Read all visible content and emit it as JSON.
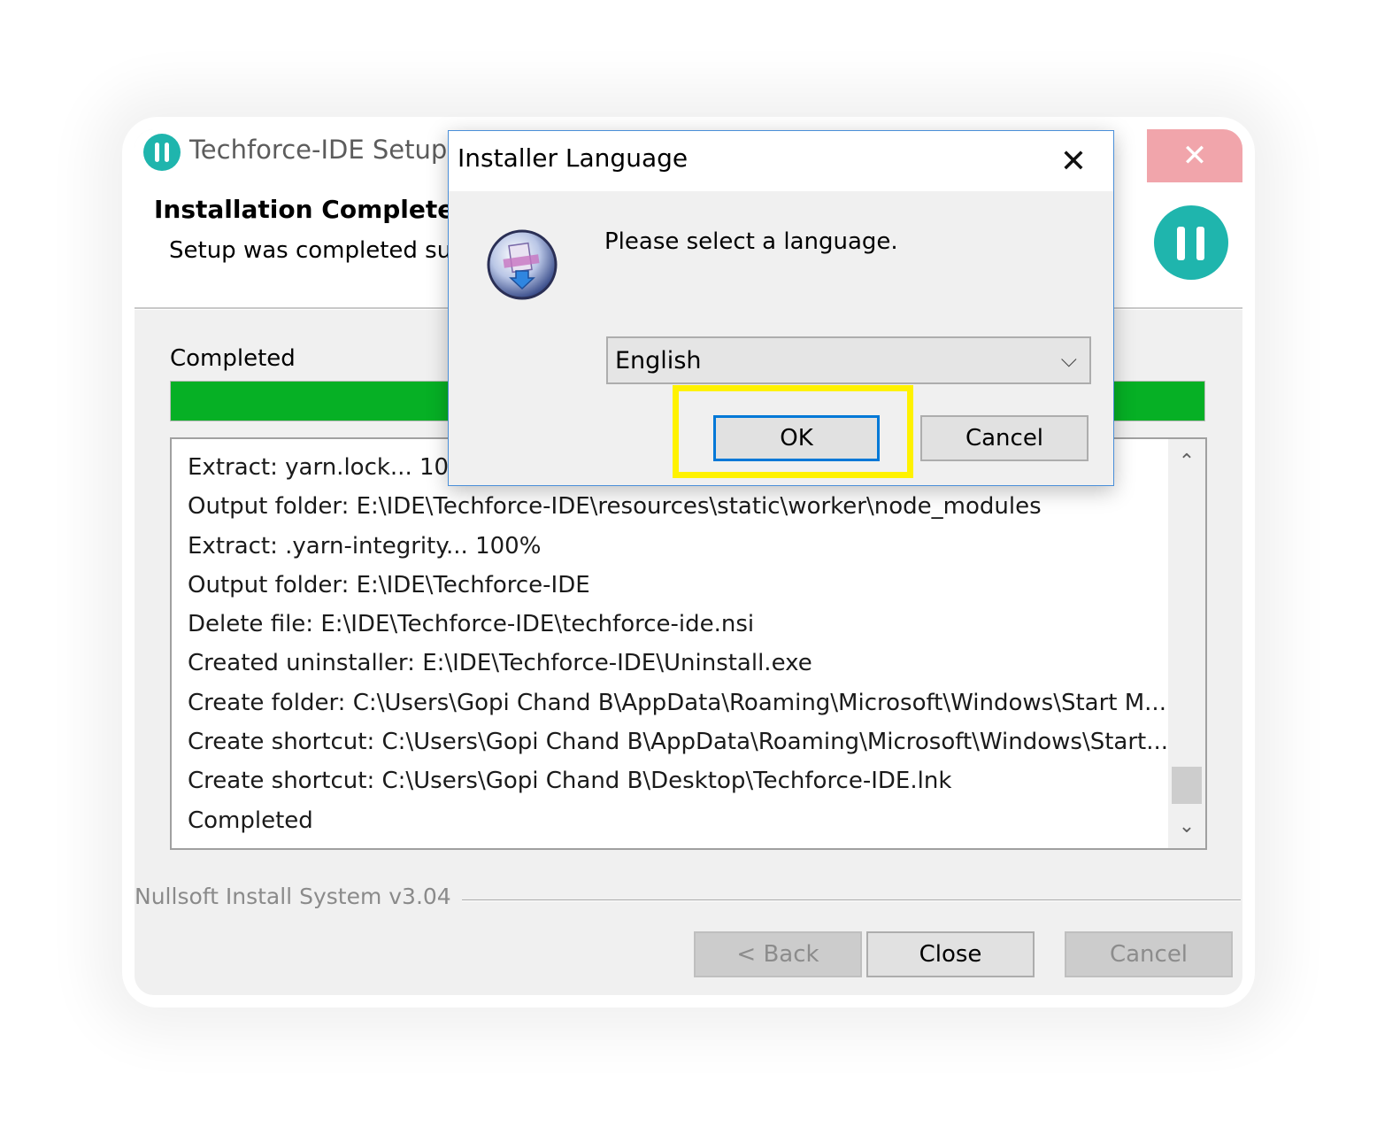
{
  "setup": {
    "window_title": "Techforce-IDE Setup",
    "close_glyph": "✕",
    "header_title": "Installation Complete",
    "header_subtitle": "Setup was completed suc",
    "status_label": "Completed",
    "progress_percent": 100,
    "progress_color": "#06b025",
    "log": [
      "Extract: yarn.lock... 10",
      "Output folder: E:\\IDE\\Techforce-IDE\\resources\\static\\worker\\node_modules",
      "Extract: .yarn-integrity... 100%",
      "Output folder: E:\\IDE\\Techforce-IDE",
      "Delete file: E:\\IDE\\Techforce-IDE\\techforce-ide.nsi",
      "Created uninstaller: E:\\IDE\\Techforce-IDE\\Uninstall.exe",
      "Create folder: C:\\Users\\Gopi Chand B\\AppData\\Roaming\\Microsoft\\Windows\\Start M...",
      "Create shortcut: C:\\Users\\Gopi Chand B\\AppData\\Roaming\\Microsoft\\Windows\\Start...",
      "Create shortcut: C:\\Users\\Gopi Chand B\\Desktop\\Techforce-IDE.lnk",
      "Completed"
    ],
    "scroll_up": "⌃",
    "scroll_down": "⌄",
    "footer_brand": "Nullsoft Install System v3.04",
    "buttons": {
      "back": "< Back",
      "close": "Close",
      "cancel": "Cancel"
    },
    "brand_color": "#1fb5ad"
  },
  "language_dialog": {
    "title": "Installer Language",
    "close_glyph": "✕",
    "prompt": "Please select a language.",
    "selected_language": "English",
    "chevron": "⌵",
    "ok_label": "OK",
    "cancel_label": "Cancel",
    "highlight_color": "#fff200",
    "icon": "installer-globe-icon"
  }
}
